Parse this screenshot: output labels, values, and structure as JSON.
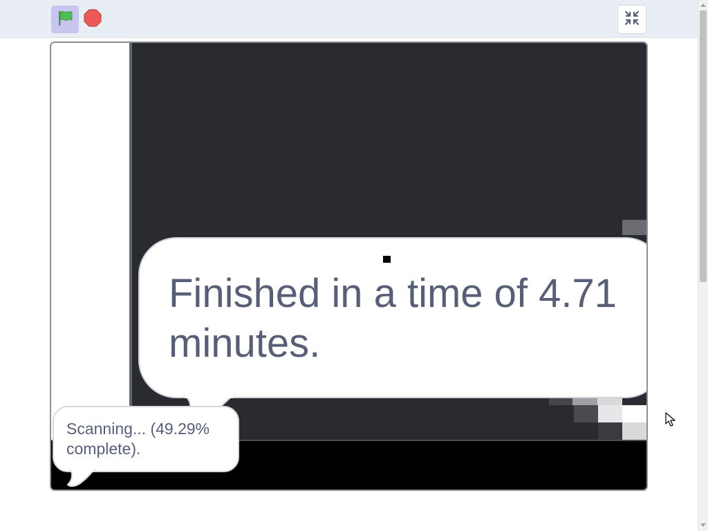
{
  "controls": {
    "green_flag_icon": "green-flag-icon",
    "stop_icon": "stop-sign-icon",
    "unfullscreen_icon": "collapse-icon",
    "green_flag_color": "#4cbf56",
    "stop_color": "#ec5959",
    "active_bg": "#c8c6f0"
  },
  "stage": {
    "bubble_main_text": "Finished in a time of 4.71\nminutes.",
    "bubble_status_text": "Scanning... (49.29%\ncomplete).",
    "dark_bg": "#2a2a31",
    "text_color": "#575e75"
  },
  "scrollbar": {
    "thumb_color": "#c1c1c1"
  }
}
